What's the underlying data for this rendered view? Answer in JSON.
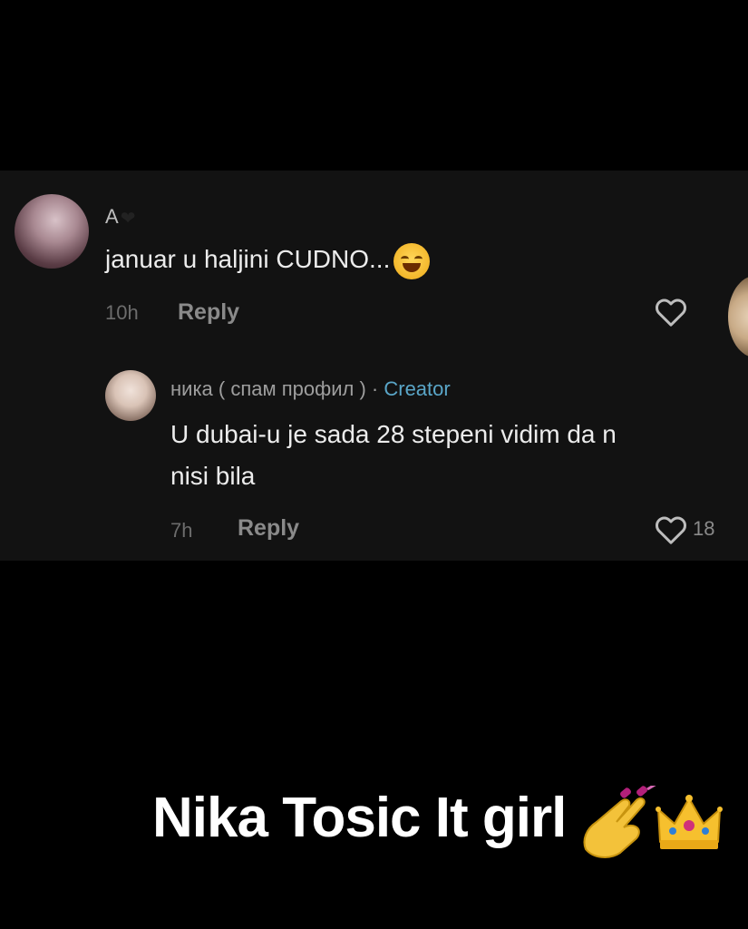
{
  "comments": {
    "main": {
      "username": "A",
      "text": "januar u haljini CUDNO...",
      "time": "10h",
      "reply_label": "Reply"
    },
    "reply": {
      "username": "ника ( спам профил )",
      "separator": "·",
      "creator_label": "Creator",
      "text": "U dubai-u je sada 28 stepeni vidim da n\nnisi bila",
      "time": "7h",
      "reply_label": "Reply",
      "like_count": "18"
    }
  },
  "caption": {
    "text": "Nika Tosic It girl"
  },
  "icons": {
    "like": "heart-outline-icon",
    "laugh": "laughing-emoji-icon",
    "nails": "nail-polish-emoji-icon",
    "crown": "crown-emoji-icon"
  },
  "colors": {
    "background": "#000000",
    "panel": "#121212",
    "creator": "#5aa6c8"
  }
}
